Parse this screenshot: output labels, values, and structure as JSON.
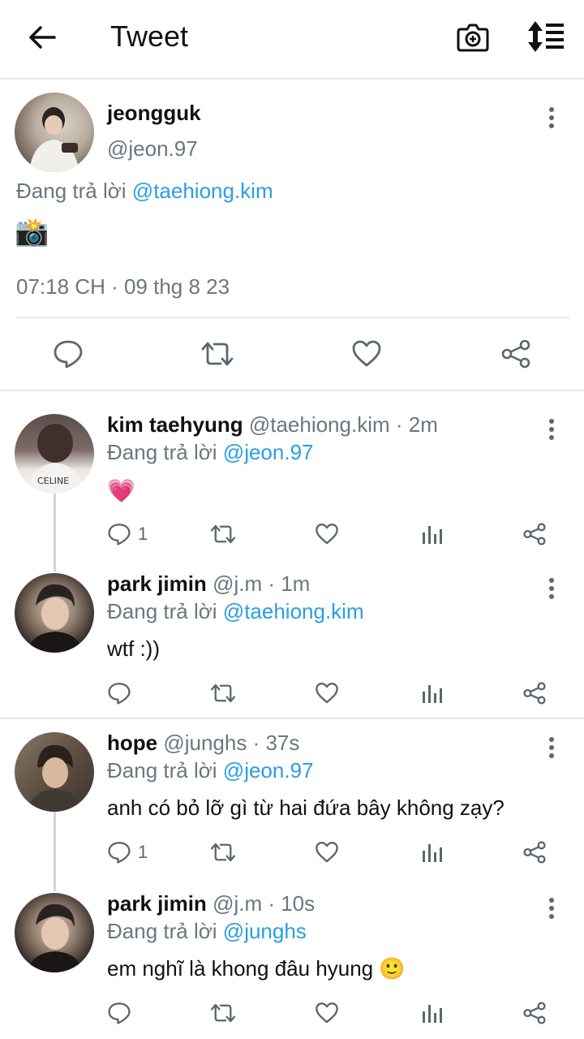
{
  "header": {
    "title": "Tweet",
    "back_icon": "arrow-left-icon",
    "camera_icon": "camera-add-icon",
    "sort_icon": "sort-list-icon"
  },
  "main_tweet": {
    "name": "jeongguk",
    "handle": "@jeon.97",
    "reply_prefix": "Đang trả lời",
    "reply_to": "@taehiong.kim",
    "emoji": "📸",
    "timestamp": "07:18 CH · 09 thg 8 23"
  },
  "replies": [
    {
      "name": "kim taehyung",
      "meta": "@taehiong.kim · 2m",
      "reply_prefix": "Đang trả lời",
      "reply_to": "@jeon.97",
      "text": "💗",
      "reply_count": "1"
    },
    {
      "name": "park jimin",
      "meta": "@j.m · 1m",
      "reply_prefix": "Đang trả lời",
      "reply_to": "@taehiong.kim",
      "text": "wtf :))",
      "reply_count": ""
    },
    {
      "name": "hope",
      "meta": "@junghs · 37s",
      "reply_prefix": "Đang trả lời",
      "reply_to": "@jeon.97",
      "text": "anh có bỏ lỡ gì từ hai đứa bây không zạy?",
      "reply_count": "1"
    },
    {
      "name": "park jimin",
      "meta": "@j.m · 10s",
      "reply_prefix": "Đang trả lời",
      "reply_to": "@junghs",
      "text": "em nghĩ là khong đâu hyung 🙂",
      "reply_count": ""
    }
  ],
  "colors": {
    "link": "#2b9de3",
    "muted": "#6b7680",
    "icon": "#5b6670"
  }
}
